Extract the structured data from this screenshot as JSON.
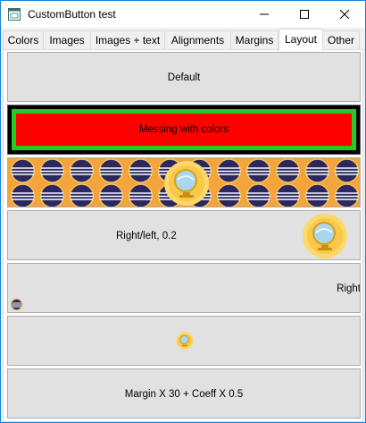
{
  "window": {
    "title": "CustomButton test",
    "icons": {
      "app": "app-window-icon",
      "minimize": "minimize-icon",
      "maximize": "maximize-icon",
      "close": "close-icon"
    }
  },
  "tabs": [
    {
      "label": "Colors",
      "active": false
    },
    {
      "label": "Images",
      "active": false
    },
    {
      "label": "Images + text",
      "active": false
    },
    {
      "label": "Alignments",
      "active": false
    },
    {
      "label": "Margins",
      "active": false
    },
    {
      "label": "Layout",
      "active": true
    },
    {
      "label": "Other",
      "active": false
    }
  ],
  "buttons": {
    "default": {
      "label": "Default"
    },
    "colors": {
      "label": "Messing with colors",
      "fg": "#ff0000",
      "border": "#22cc22",
      "outer": "#000000"
    },
    "tiled": {
      "label": "",
      "icon": "globe-icon",
      "tile_icon": "striped-ball-icon"
    },
    "right_left": {
      "label": "Right/left, 0.2",
      "icon": "globe-icon"
    },
    "right": {
      "label": "Right",
      "icon": "striped-ball-icon"
    },
    "small_icon": {
      "label": "",
      "icon": "globe-icon"
    },
    "margin": {
      "label": "Margin X 30 + Coeff X 0.5"
    }
  }
}
